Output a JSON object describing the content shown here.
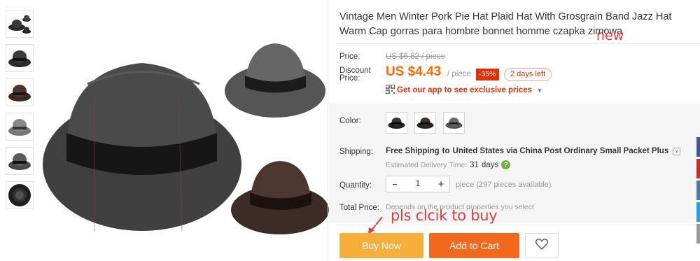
{
  "product": {
    "title": "Vintage Men Winter Pork Pie Hat Plaid Hat With Grosgrain Band Jazz Hat Warm Cap gorras para hombre bonnet homme czapka zimowa"
  },
  "annotations": {
    "new": "new",
    "click_to_buy": "pls clcik to buy"
  },
  "price": {
    "price_label": "Price:",
    "original": "US $6.82 / piece",
    "discount_label_1": "Discount",
    "discount_label_2": "Price:",
    "discount_price": "US $4.43",
    "per_piece": "/ piece",
    "discount_percent": "-35%",
    "days_left": "2 days left",
    "app_promo": "Get our app to see exclusive prices",
    "accent_color": "#ff6600"
  },
  "color": {
    "label": "Color:",
    "swatches": [
      "black-hat",
      "brown-hat",
      "gray-hat"
    ]
  },
  "shipping": {
    "label": "Shipping:",
    "free": "Free Shipping",
    "to_text": "to",
    "destination": "United States via China Post Ordinary Small Packet Plus",
    "est_label": "Estimated Delivery Time:",
    "days": "31",
    "days_unit": "days"
  },
  "quantity": {
    "label": "Quantity:",
    "minus": "−",
    "value": "1",
    "plus": "+",
    "available": "piece (297 pieces available)"
  },
  "total": {
    "label": "Total Price:",
    "note": "Depends on the product properties you select"
  },
  "actions": {
    "buy_now": "Buy Now",
    "add_to_cart": "Add to Cart"
  },
  "icons": {
    "wishlist": "heart-icon",
    "qr": "qr-code-icon",
    "help": "question-icon"
  }
}
